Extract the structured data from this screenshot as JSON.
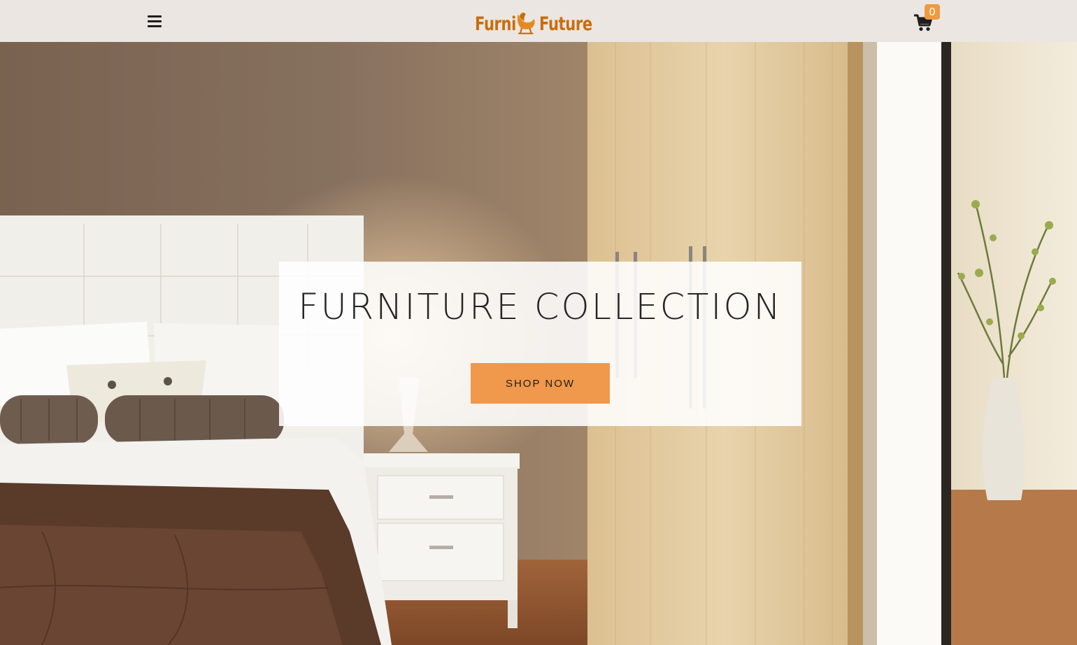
{
  "header": {
    "menu_icon": "hamburger-menu-icon",
    "logo": {
      "text_left": "Furni",
      "text_right": "Future",
      "icon": "armchair-icon",
      "color": "#c86d0e"
    },
    "cart": {
      "icon": "shopping-cart-icon",
      "count": "0",
      "badge_color": "#f09a3e"
    }
  },
  "hero": {
    "background": "bedroom-photo",
    "title": "FURNITURE COLLECTION",
    "cta_label": "SHOP NOW",
    "cta_color": "#f0984b"
  }
}
